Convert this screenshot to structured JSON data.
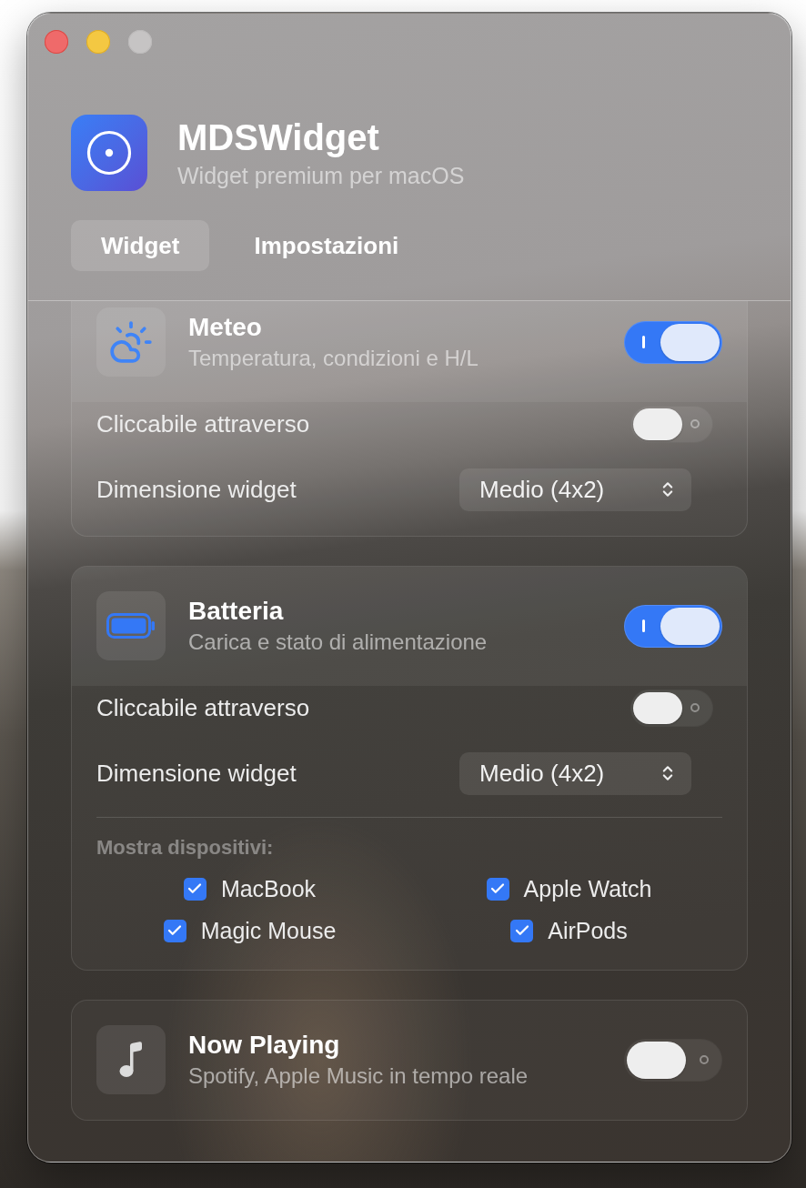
{
  "window_controls": [
    {
      "kind": "close",
      "disabled": false
    },
    {
      "kind": "minimize",
      "disabled": false
    },
    {
      "kind": "zoom",
      "disabled": true
    }
  ],
  "app": {
    "name": "MDSWidget",
    "tagline": "Widget premium per macOS"
  },
  "tabs": [
    {
      "label": "Widget",
      "selected": true
    },
    {
      "label": "Impostazioni",
      "selected": false
    }
  ],
  "widgets": [
    {
      "kind": "weather",
      "title": "Meteo",
      "subtitle": "Temperatura, condizioni e H/L",
      "on": true,
      "settings": [
        {
          "kind": "switch",
          "label": "Cliccabile attraverso",
          "on": false
        },
        {
          "kind": "select",
          "label": "Dimensione widget",
          "value": "Medio (4x2)"
        }
      ]
    },
    {
      "kind": "battery",
      "title": "Batteria",
      "subtitle": "Carica e stato di alimentazione",
      "on": true,
      "settings": [
        {
          "kind": "switch",
          "label": "Cliccabile attraverso",
          "on": false
        },
        {
          "kind": "select",
          "label": "Dimensione widget",
          "value": "Medio (4x2)"
        }
      ],
      "devices": {
        "label": "Mostra dispositivi:",
        "items": [
          {
            "label": "MacBook",
            "checked": true
          },
          {
            "label": "Apple Watch",
            "checked": true
          },
          {
            "label": "Magic Mouse",
            "checked": true
          },
          {
            "label": "AirPods",
            "checked": true
          }
        ]
      }
    },
    {
      "kind": "music",
      "title": "Now Playing",
      "subtitle": "Spotify, Apple Music in tempo reale",
      "on": false
    }
  ]
}
